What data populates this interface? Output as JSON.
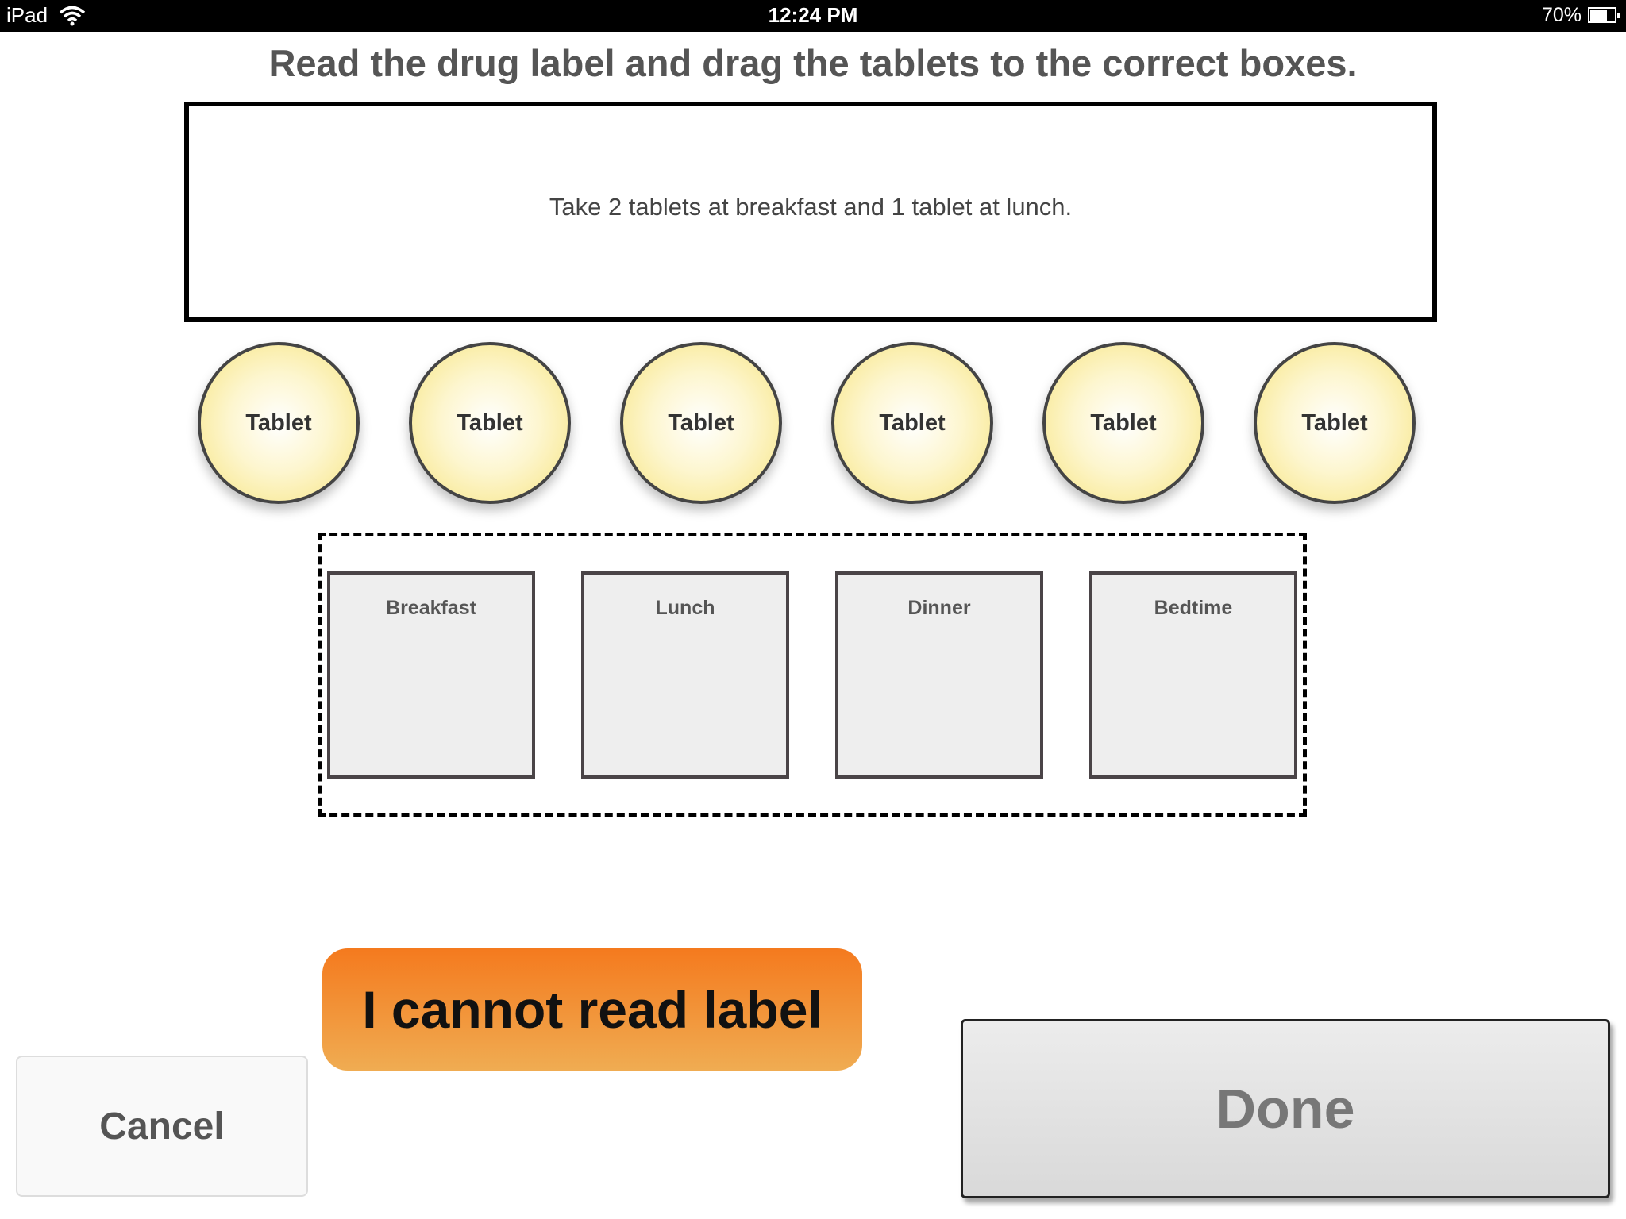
{
  "status_bar": {
    "device": "iPad",
    "time": "12:24 PM",
    "battery_percent": "70%",
    "battery_level": 0.7,
    "wifi_icon": "wifi-icon"
  },
  "instruction": "Read the drug label and drag the tablets to the correct boxes.",
  "drug_label": {
    "text": "Take 2 tablets at breakfast and 1 tablet at lunch."
  },
  "tablets": [
    {
      "label": "Tablet"
    },
    {
      "label": "Tablet"
    },
    {
      "label": "Tablet"
    },
    {
      "label": "Tablet"
    },
    {
      "label": "Tablet"
    },
    {
      "label": "Tablet"
    }
  ],
  "slots": [
    {
      "label": "Breakfast"
    },
    {
      "label": "Lunch"
    },
    {
      "label": "Dinner"
    },
    {
      "label": "Bedtime"
    }
  ],
  "buttons": {
    "cannot_read": "I cannot read label",
    "cancel": "Cancel",
    "done": "Done"
  },
  "colors": {
    "tablet_fill": "#f7e47f",
    "cannot_read_top": "#f47a1e",
    "cannot_read_bottom": "#f0ac52"
  }
}
